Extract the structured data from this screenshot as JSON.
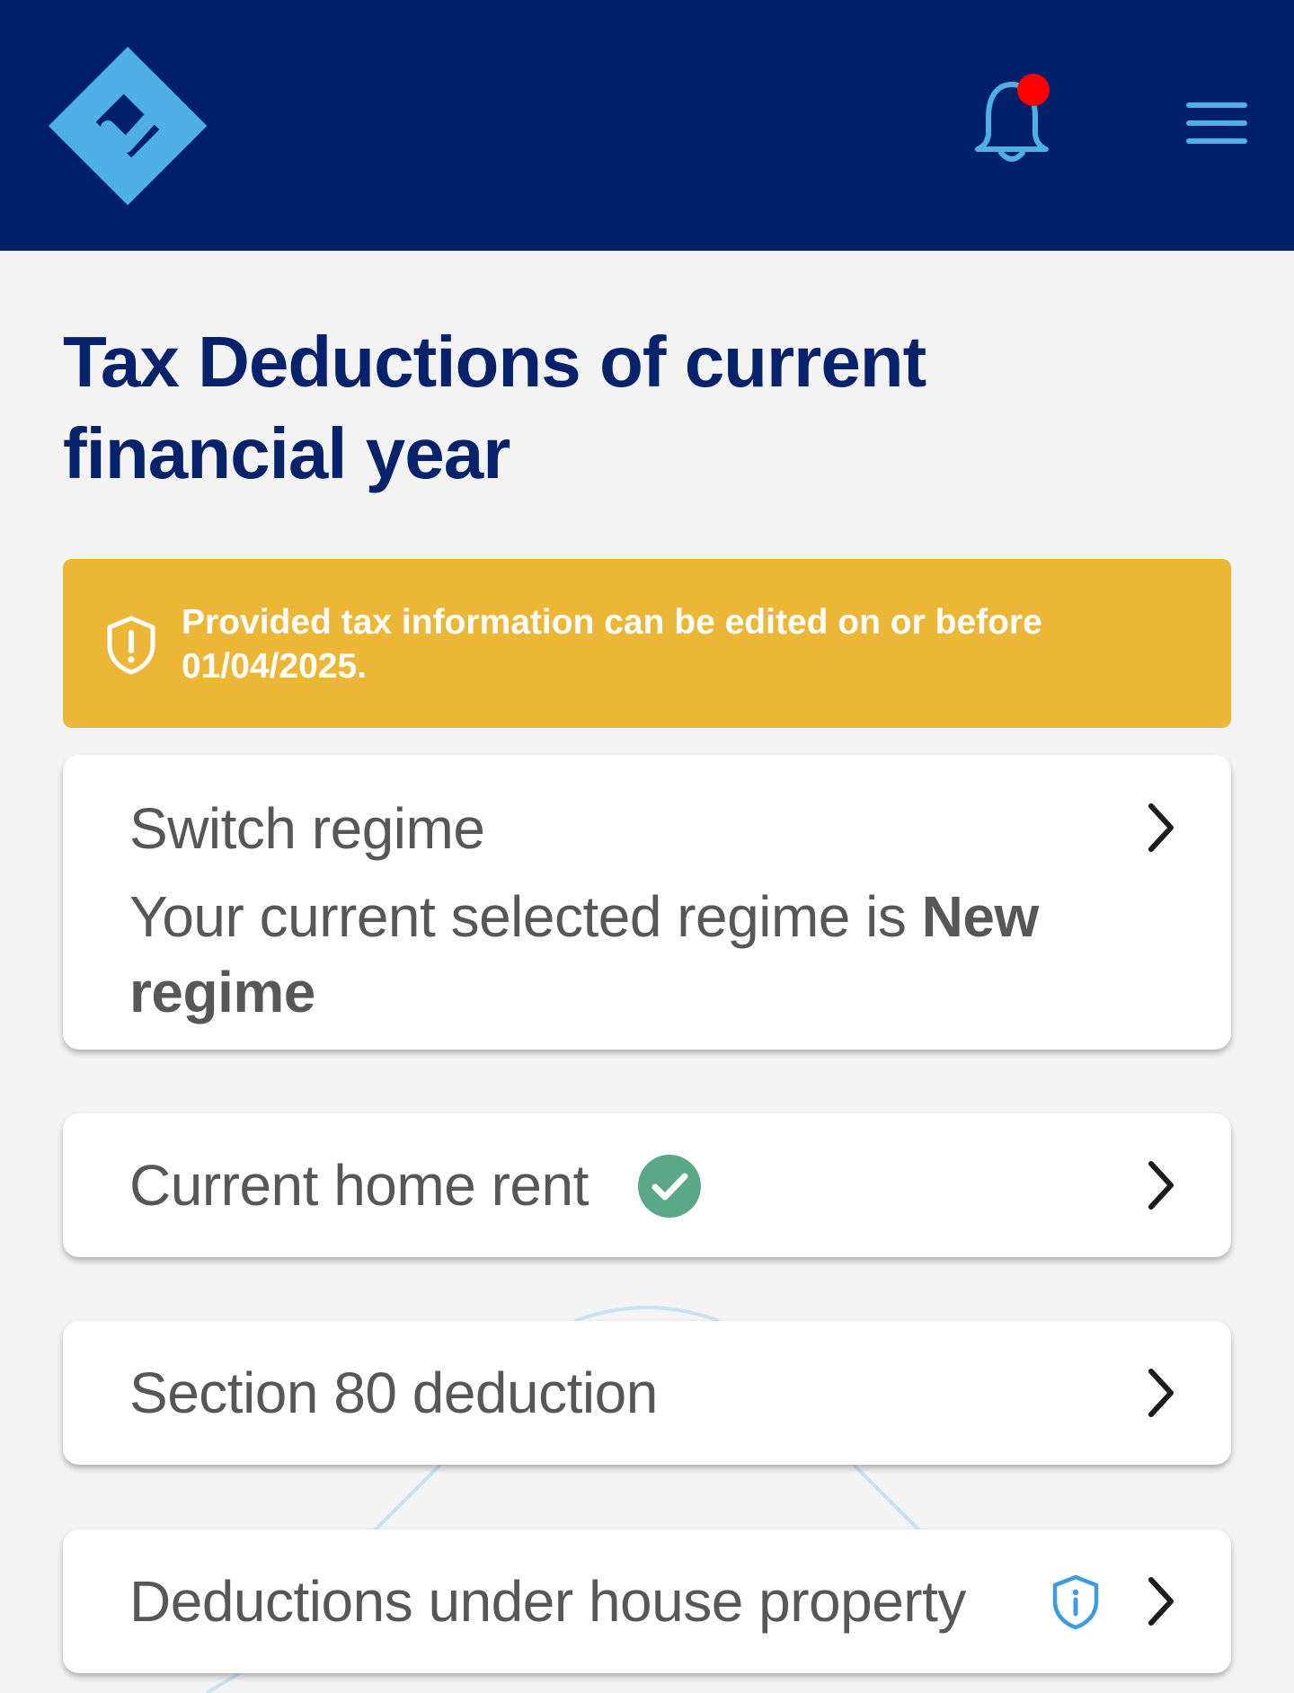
{
  "header": {
    "logo_icon": "checkmark-diamond-logo",
    "notification_icon": "bell-icon",
    "notification_dot_color": "#ff0000",
    "menu_icon": "hamburger-menu-icon"
  },
  "page": {
    "title_line1": "Tax Deductions of current",
    "title_line2": "financial year"
  },
  "notice": {
    "icon": "shield-alert-icon",
    "line1": "Provided tax information can be edited on or before",
    "line2": "01/04/2025.",
    "color": "#ecb637"
  },
  "cards": {
    "switch_regime": {
      "title": "Switch regime",
      "subtitle_prefix": "Your current selected regime is ",
      "subtitle_bold": "New regime"
    },
    "home_rent": {
      "title": "Current home rent",
      "status_icon": "check-circle-icon",
      "status_color": "#5ba889"
    },
    "section80": {
      "title": "Section 80 deduction"
    },
    "house_property": {
      "title": "Deductions under house property",
      "info_icon": "info-shield-icon"
    }
  },
  "colors": {
    "header_bg": "#002169",
    "title": "#06226b",
    "accent_blue": "#4fb0e6"
  }
}
